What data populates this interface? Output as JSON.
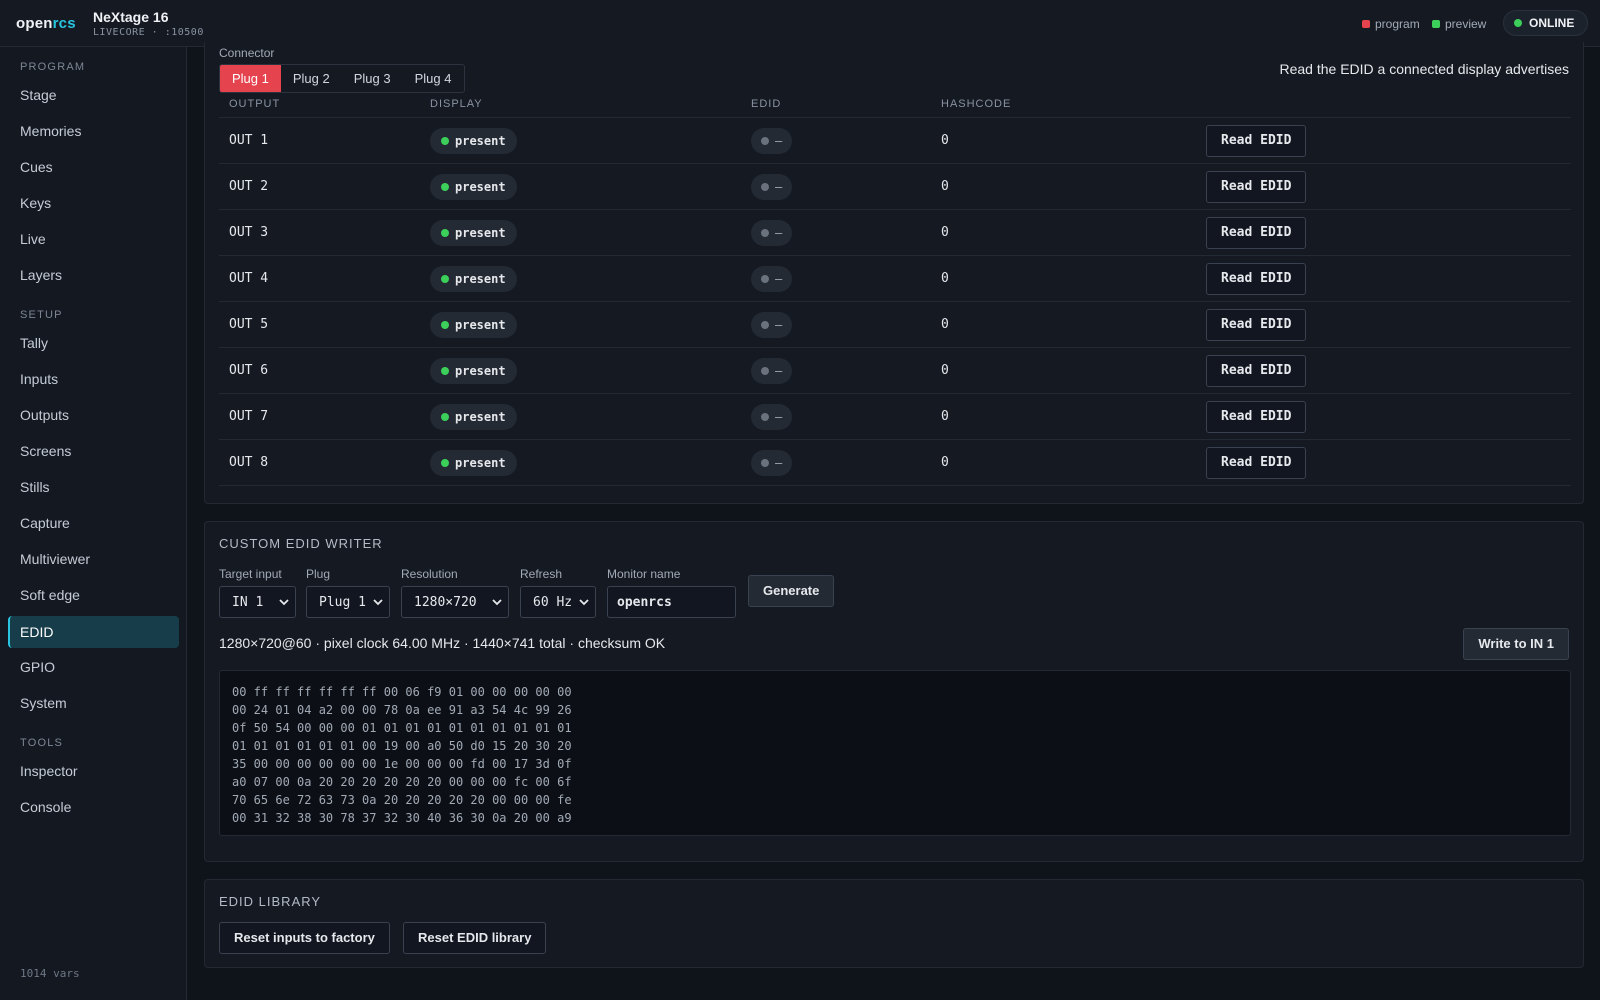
{
  "brand": {
    "part1": "open",
    "part2": "rcs"
  },
  "device": {
    "name": "NeXtage 16",
    "sub": "LIVECORE · :10500"
  },
  "legend": [
    {
      "label": "program",
      "color": "#e5434e"
    },
    {
      "label": "preview",
      "color": "#3ccf5a"
    }
  ],
  "status": {
    "label": "ONLINE",
    "color": "#3ccf5a"
  },
  "sidebar": {
    "sections": [
      {
        "title": "PROGRAM",
        "items": [
          "Stage",
          "Memories",
          "Cues",
          "Keys",
          "Live",
          "Layers"
        ]
      },
      {
        "title": "SETUP",
        "items": [
          "Tally",
          "Inputs",
          "Outputs",
          "Screens",
          "Stills",
          "Capture",
          "Multiviewer",
          "Soft edge",
          "EDID",
          "GPIO",
          "System"
        ]
      },
      {
        "title": "TOOLS",
        "items": [
          "Inspector",
          "Console"
        ]
      }
    ],
    "active": "EDID",
    "footer": "1014 vars"
  },
  "connectors": {
    "label": "Connector",
    "plugs": [
      "Plug 1",
      "Plug 2",
      "Plug 3",
      "Plug 4"
    ],
    "active_plug": "Plug 1",
    "hint": "Read the EDID a connected display advertises",
    "columns": [
      "OUTPUT",
      "DISPLAY",
      "EDID",
      "HASHCODE"
    ],
    "rows": [
      {
        "output": "OUT 1",
        "display": "present",
        "edid": "—",
        "hashcode": "0",
        "action": "Read EDID"
      },
      {
        "output": "OUT 2",
        "display": "present",
        "edid": "—",
        "hashcode": "0",
        "action": "Read EDID"
      },
      {
        "output": "OUT 3",
        "display": "present",
        "edid": "—",
        "hashcode": "0",
        "action": "Read EDID"
      },
      {
        "output": "OUT 4",
        "display": "present",
        "edid": "—",
        "hashcode": "0",
        "action": "Read EDID"
      },
      {
        "output": "OUT 5",
        "display": "present",
        "edid": "—",
        "hashcode": "0",
        "action": "Read EDID"
      },
      {
        "output": "OUT 6",
        "display": "present",
        "edid": "—",
        "hashcode": "0",
        "action": "Read EDID"
      },
      {
        "output": "OUT 7",
        "display": "present",
        "edid": "—",
        "hashcode": "0",
        "action": "Read EDID"
      },
      {
        "output": "OUT 8",
        "display": "present",
        "edid": "—",
        "hashcode": "0",
        "action": "Read EDID"
      }
    ]
  },
  "writer": {
    "title": "CUSTOM EDID WRITER",
    "fields": {
      "target_input": {
        "label": "Target input",
        "value": "IN 1"
      },
      "plug": {
        "label": "Plug",
        "value": "Plug 1"
      },
      "resolution": {
        "label": "Resolution",
        "value": "1280×720"
      },
      "refresh": {
        "label": "Refresh",
        "value": "60 Hz"
      },
      "monitor_name": {
        "label": "Monitor name",
        "value": "openrcs"
      }
    },
    "generate_label": "Generate",
    "summary": "1280×720@60 · pixel clock 64.00 MHz · 1440×741 total · checksum OK",
    "write_label": "Write to IN 1",
    "hex": [
      "00 ff ff ff ff ff ff 00 06 f9 01 00 00 00 00 00",
      "00 24 01 04 a2 00 00 78 0a ee 91 a3 54 4c 99 26",
      "0f 50 54 00 00 00 01 01 01 01 01 01 01 01 01 01",
      "01 01 01 01 01 01 00 19 00 a0 50 d0 15 20 30 20",
      "35 00 00 00 00 00 00 1e 00 00 00 fd 00 17 3d 0f",
      "a0 07 00 0a 20 20 20 20 20 20 00 00 00 fc 00 6f",
      "70 65 6e 72 63 73 0a 20 20 20 20 20 00 00 00 fe",
      "00 31 32 38 30 78 37 32 30 40 36 30 0a 20 00 a9"
    ]
  },
  "library": {
    "title": "EDID LIBRARY",
    "reset_inputs_label": "Reset inputs to factory",
    "reset_library_label": "Reset EDID library"
  }
}
